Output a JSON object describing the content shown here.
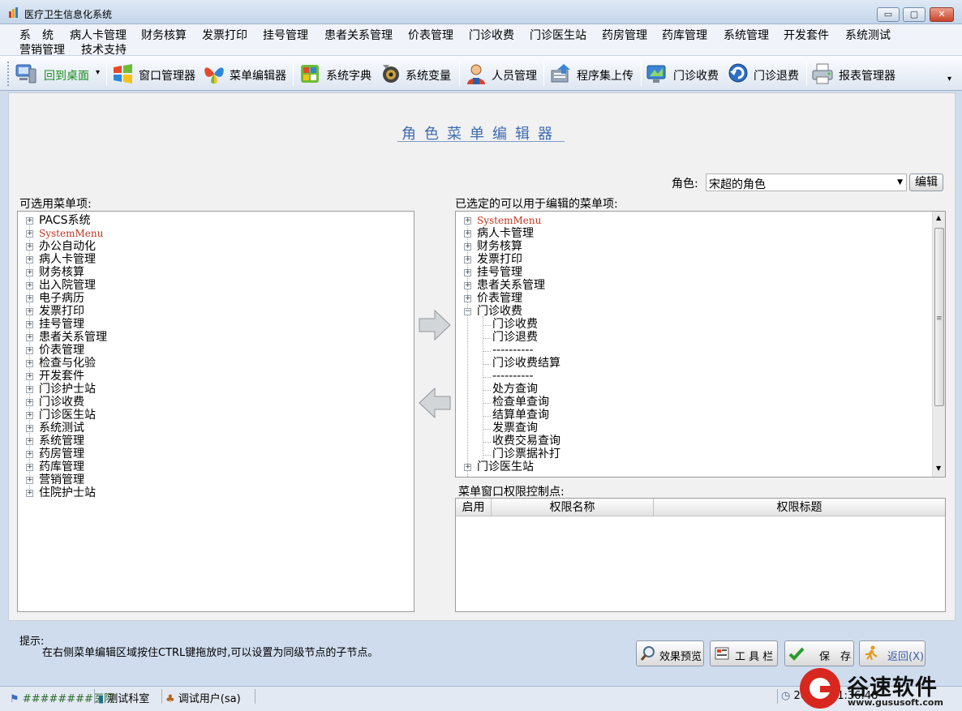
{
  "window": {
    "title": "医疗卫生信息化系统",
    "buttons": {
      "minimize": "▭",
      "maximize": "▢",
      "close": "✕"
    }
  },
  "menubar": {
    "items": [
      "系　统",
      "病人卡管理",
      "财务核算",
      "发票打印",
      "挂号管理",
      "患者关系管理",
      "价表管理",
      "门诊收费",
      "门诊医生站",
      "药房管理",
      "药库管理",
      "系统管理",
      "开发套件",
      "系统测试",
      "营销管理",
      "技术支持"
    ]
  },
  "toolbar": {
    "items": [
      {
        "label": "回到桌面",
        "icon": "computer-icon",
        "color": "#1c8c1c"
      },
      {
        "label": "窗口管理器",
        "icon": "windows-logo-icon",
        "color": "#000000"
      },
      {
        "label": "菜单编辑器",
        "icon": "butterfly-icon",
        "color": "#000000"
      },
      {
        "label": "系统字典",
        "icon": "dictionary-icon",
        "color": "#000000"
      },
      {
        "label": "系统变量",
        "icon": "speaker-icon",
        "color": "#000000"
      },
      {
        "label": "人员管理",
        "icon": "person-icon",
        "color": "#000000"
      },
      {
        "label": "程序集上传",
        "icon": "server-upload-icon",
        "color": "#000000"
      },
      {
        "label": "门诊收费",
        "icon": "monitor-icon",
        "color": "#000000"
      },
      {
        "label": "门诊退费",
        "icon": "refund-icon",
        "color": "#000000"
      },
      {
        "label": "报表管理器",
        "icon": "printer-icon",
        "color": "#000000"
      }
    ],
    "dropdown_glyph": "▾"
  },
  "editor": {
    "title": "角色菜单编辑器",
    "role_label": "角色:",
    "role_value": "宋超的角色",
    "edit_button": "编辑",
    "left_label": "可选用菜单项:",
    "right_label": "已选定的可以用于编辑的菜单项:",
    "available_items": [
      "PACS系统",
      "SystemMenu",
      "办公自动化",
      "病人卡管理",
      "财务核算",
      "出入院管理",
      "电子病历",
      "发票打印",
      "挂号管理",
      "患者关系管理",
      "价表管理",
      "检查与化验",
      "开发套件",
      "门诊护士站",
      "门诊收费",
      "门诊医生站",
      "系统测试",
      "系统管理",
      "药房管理",
      "药库管理",
      "营销管理",
      "住院护士站"
    ],
    "selected_items": [
      {
        "label": "SystemMenu",
        "level": 0,
        "expand": "+",
        "red": true
      },
      {
        "label": "病人卡管理",
        "level": 0,
        "expand": "+"
      },
      {
        "label": "财务核算",
        "level": 0,
        "expand": "+"
      },
      {
        "label": "发票打印",
        "level": 0,
        "expand": "+"
      },
      {
        "label": "挂号管理",
        "level": 0,
        "expand": "+"
      },
      {
        "label": "患者关系管理",
        "level": 0,
        "expand": "+"
      },
      {
        "label": "价表管理",
        "level": 0,
        "expand": "+"
      },
      {
        "label": "门诊收费",
        "level": 0,
        "expand": "−"
      },
      {
        "label": "门诊收费",
        "level": 1
      },
      {
        "label": "门诊退费",
        "level": 1
      },
      {
        "label": "----------",
        "level": 1
      },
      {
        "label": "门诊收费结算",
        "level": 1
      },
      {
        "label": "----------",
        "level": 1
      },
      {
        "label": "处方查询",
        "level": 1
      },
      {
        "label": "检查单查询",
        "level": 1
      },
      {
        "label": "结算单查询",
        "level": 1
      },
      {
        "label": "发票查询",
        "level": 1
      },
      {
        "label": "收费交易查询",
        "level": 1
      },
      {
        "label": "门诊票据补打",
        "level": 1
      },
      {
        "label": "门诊医生站",
        "level": 0,
        "expand": "+"
      }
    ],
    "permission_label": "菜单窗口权限控制点:",
    "grid_columns": [
      "启用",
      "权限名称",
      "权限标题"
    ]
  },
  "hint": {
    "title": "提示:",
    "text": "在右侧菜单编辑区域按住CTRL键拖放时,可以设置为同级节点的子节点。"
  },
  "actions": [
    {
      "label": "效果预览",
      "icon": "magnifier-icon"
    },
    {
      "label": "工 具 栏",
      "icon": "toolbar-icon"
    },
    {
      "label": "保　存",
      "icon": "checkmark-icon"
    },
    {
      "label": "返回(X)",
      "icon": "runner-icon"
    }
  ],
  "statusbar": {
    "hospital": "########医院",
    "department": "测试科室",
    "user": "调试用户(sa)",
    "datetime": "20 4 1 11:36:48"
  },
  "watermark": {
    "brand": "谷速软件",
    "url": "www.gususoft.com"
  },
  "colors": {
    "accent": "#3e6cb0",
    "red_item": "#c0341f",
    "desktop_green": "#1c8c1c"
  }
}
